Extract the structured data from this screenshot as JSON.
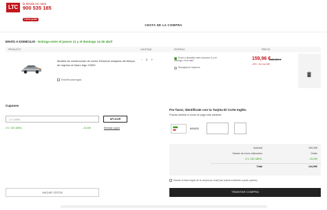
{
  "header": {
    "logo": "LTC",
    "contact_line": "la tienda en casa",
    "phone": "900 535 185",
    "badge": "Llama gratis"
  },
  "page_title": "CESTA DE LA COMPRA",
  "delivery": {
    "heading": "ENVÍO A DOMICILIO",
    "window": "Entrega entre el jueves 11 y el domingo 14 de abril"
  },
  "columns": {
    "product": "PRODUCTO",
    "quantity": "CANTIDAD",
    "delivery": "ENTREGA",
    "price": "PRECIO"
  },
  "product": {
    "name": "Modelo de construcción de coche Delorean máquina del tiempo de regreso al futuro lego 10300",
    "gift_option": "Envolver para regalo",
    "qty_minus": "-",
    "qty_value": "1",
    "qty_plus": "+",
    "delivery_home": "Envío a domicilio entre el jueves 11 y el domingo 14 de abril",
    "delivery_pickup": "Recogida en Supercor",
    "price": "159,96 €",
    "price_old": "199,99 €",
    "discount": "-20% · Ahorras 40€"
  },
  "coupons": {
    "heading": "Cupones",
    "placeholder": "LTC ABRIL",
    "apply": "APLICAR",
    "applied_code": "LTC 15E ABRIL",
    "applied_amount": "-15,00€",
    "remove": "Eliminar cupón"
  },
  "identify": {
    "heading": "Por favor, identifícate con tu Tarjeta El Corte Inglés.",
    "sub": "Podrás cambiar el modo de pago más adelante.",
    "card_prefix": "600633"
  },
  "summary": {
    "rows": [
      {
        "label": "Subtotal",
        "value": "159,99€"
      },
      {
        "label": "Gastos de envío estimados",
        "value": "Gratis"
      },
      {
        "label": "LTC 15E ABRIL",
        "value": "-15,00€"
      },
      {
        "label": "Total",
        "value": "144,99€"
      }
    ]
  },
  "gift_ticket": "Desdeo el ticket regalo de la compra por email (así podrás enviárselo a quien quieras)",
  "actions": {
    "empty_cart": "VACIAR CESTA",
    "checkout": "TRAMITAR COMPRA"
  },
  "colors": {
    "brand": "#c4161c",
    "accent_green": "#3a9d23",
    "dark": "#222222"
  }
}
